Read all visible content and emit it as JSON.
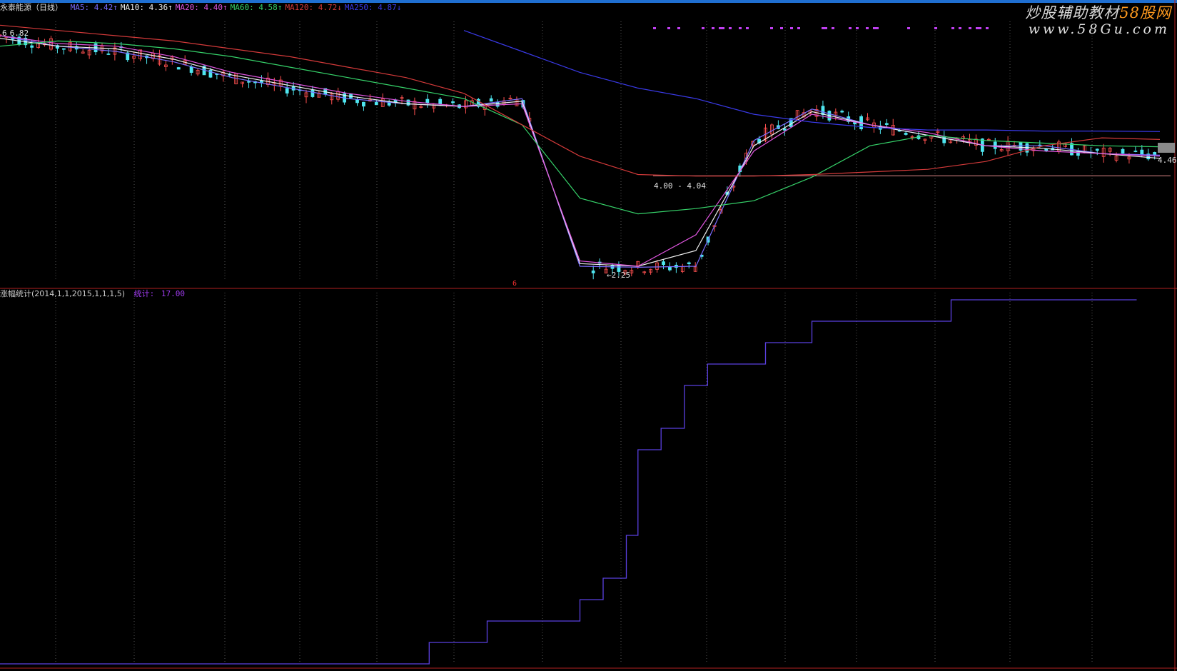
{
  "header": {
    "stock_name": "永泰能源（日线）",
    "ma_items": [
      {
        "label": "MA5:",
        "value": "4.42",
        "arrow": "↑",
        "color": "#7b6cff"
      },
      {
        "label": "MA10:",
        "value": "4.36",
        "arrow": "↑",
        "color": "#f0f0f0"
      },
      {
        "label": "MA20:",
        "value": "4.40",
        "arrow": "↑",
        "color": "#e055e0"
      },
      {
        "label": "MA60:",
        "value": "4.58",
        "arrow": "↑",
        "color": "#36d36a"
      },
      {
        "label": "MA120:",
        "value": "4.72",
        "arrow": "↓",
        "color": "#d43a3a"
      },
      {
        "label": "MA250:",
        "value": "4.87",
        "arrow": "↓",
        "color": "#3a3ae8"
      }
    ]
  },
  "watermark": {
    "line1_a": "炒股辅助教材",
    "line1_b": "58股网",
    "line2": "www.58Gu.com"
  },
  "price_labels": {
    "top_left": "6.82",
    "range": "4.00 - 4.04",
    "low": "2.25",
    "right_price": "4.46",
    "marker": "6"
  },
  "sub_panel": {
    "indicator": "涨幅统计(2014,1,1,2015,1,1,1,5)",
    "stat_label": "统计:",
    "stat_value": "17.00"
  },
  "chart_data": [
    {
      "type": "line",
      "title": "永泰能源（日线）",
      "x": [
        0,
        5,
        10,
        15,
        20,
        25,
        30,
        35,
        40,
        45,
        50,
        55,
        60,
        65,
        70,
        75,
        80,
        85,
        90,
        95,
        100
      ],
      "series": [
        {
          "name": "MA5",
          "color": "#7b6cff",
          "values": [
            6.7,
            6.5,
            6.4,
            6.2,
            5.9,
            5.7,
            5.5,
            5.4,
            5.35,
            5.5,
            2.3,
            2.28,
            2.3,
            4.7,
            5.3,
            5.0,
            4.8,
            4.6,
            4.6,
            4.45,
            4.42
          ]
        },
        {
          "name": "MA10",
          "color": "#f0f0f0",
          "values": [
            6.65,
            6.5,
            6.45,
            6.25,
            5.95,
            5.75,
            5.55,
            5.4,
            5.35,
            5.45,
            2.35,
            2.3,
            2.6,
            4.6,
            5.25,
            5.0,
            4.8,
            4.6,
            4.55,
            4.45,
            4.36
          ]
        },
        {
          "name": "MA20",
          "color": "#e055e0",
          "values": [
            6.7,
            6.55,
            6.5,
            6.3,
            6.0,
            5.8,
            5.6,
            5.45,
            5.35,
            5.4,
            2.4,
            2.3,
            2.9,
            4.5,
            5.2,
            5.0,
            4.85,
            4.6,
            4.5,
            4.45,
            4.4
          ]
        },
        {
          "name": "MA60",
          "color": "#36d36a",
          "values": [
            6.5,
            6.6,
            6.55,
            6.45,
            6.3,
            6.1,
            5.9,
            5.7,
            5.5,
            5.0,
            3.6,
            3.3,
            3.4,
            3.55,
            4.0,
            4.6,
            4.8,
            4.7,
            4.65,
            4.6,
            4.58
          ]
        },
        {
          "name": "MA120",
          "color": "#d43a3a",
          "values": [
            6.9,
            6.8,
            6.7,
            6.6,
            6.45,
            6.3,
            6.1,
            5.9,
            5.6,
            5.0,
            4.4,
            4.05,
            4.02,
            4.02,
            4.05,
            4.1,
            4.15,
            4.3,
            4.6,
            4.75,
            4.72
          ]
        },
        {
          "name": "MA250",
          "color": "#3a3ae8",
          "values": [
            null,
            null,
            null,
            null,
            null,
            null,
            null,
            null,
            6.8,
            6.4,
            6.0,
            5.7,
            5.5,
            5.2,
            5.05,
            4.95,
            4.9,
            4.9,
            4.88,
            4.88,
            4.87
          ]
        }
      ],
      "ylim": [
        2.0,
        7.0
      ]
    },
    {
      "type": "line",
      "title": "涨幅统计(2014,1,1,2015,1,1,1,5)",
      "x": [
        0,
        37,
        37,
        42,
        42,
        50,
        50,
        52,
        52,
        54,
        54,
        55,
        55,
        57,
        57,
        59,
        59,
        61,
        61,
        66,
        66,
        70,
        70,
        82,
        82,
        98
      ],
      "series": [
        {
          "name": "统计",
          "color": "#5a40e0",
          "values": [
            0,
            0,
            1,
            1,
            2,
            2,
            3,
            3,
            4,
            4,
            6,
            6,
            10,
            10,
            11,
            11,
            13,
            13,
            14,
            14,
            15,
            15,
            16,
            16,
            17,
            17
          ]
        }
      ],
      "ylim": [
        0,
        17
      ]
    }
  ]
}
